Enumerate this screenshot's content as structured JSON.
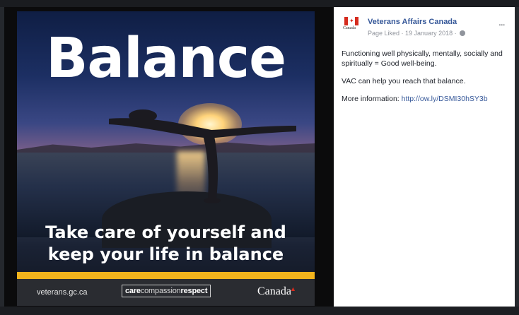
{
  "image": {
    "headline": "Balance",
    "tagline_line1": "Take care of yourself and",
    "tagline_line2": "keep your life in balance",
    "footer": {
      "website": "veterans.gc.ca",
      "badge_bold": "care",
      "badge_light": "compassion",
      "badge_bold2": "respect",
      "wordmark": "Canada"
    }
  },
  "post": {
    "page_name": "Veterans Affairs Canada",
    "meta": "Page Liked · 19 January 2018 ·",
    "more_icon": "...",
    "logo_text": "Canada",
    "paragraphs": {
      "p1": "Functioning well physically, mentally, socially and spiritually = Good well-being.",
      "p2": "VAC can help you reach that balance.",
      "p3_prefix": "More information:",
      "p3_link": "http://ow.ly/DSMI30hSY3b"
    }
  },
  "colors": {
    "link": "#365899",
    "gold": "#f2b31c",
    "flag_red": "#d52b1e"
  }
}
